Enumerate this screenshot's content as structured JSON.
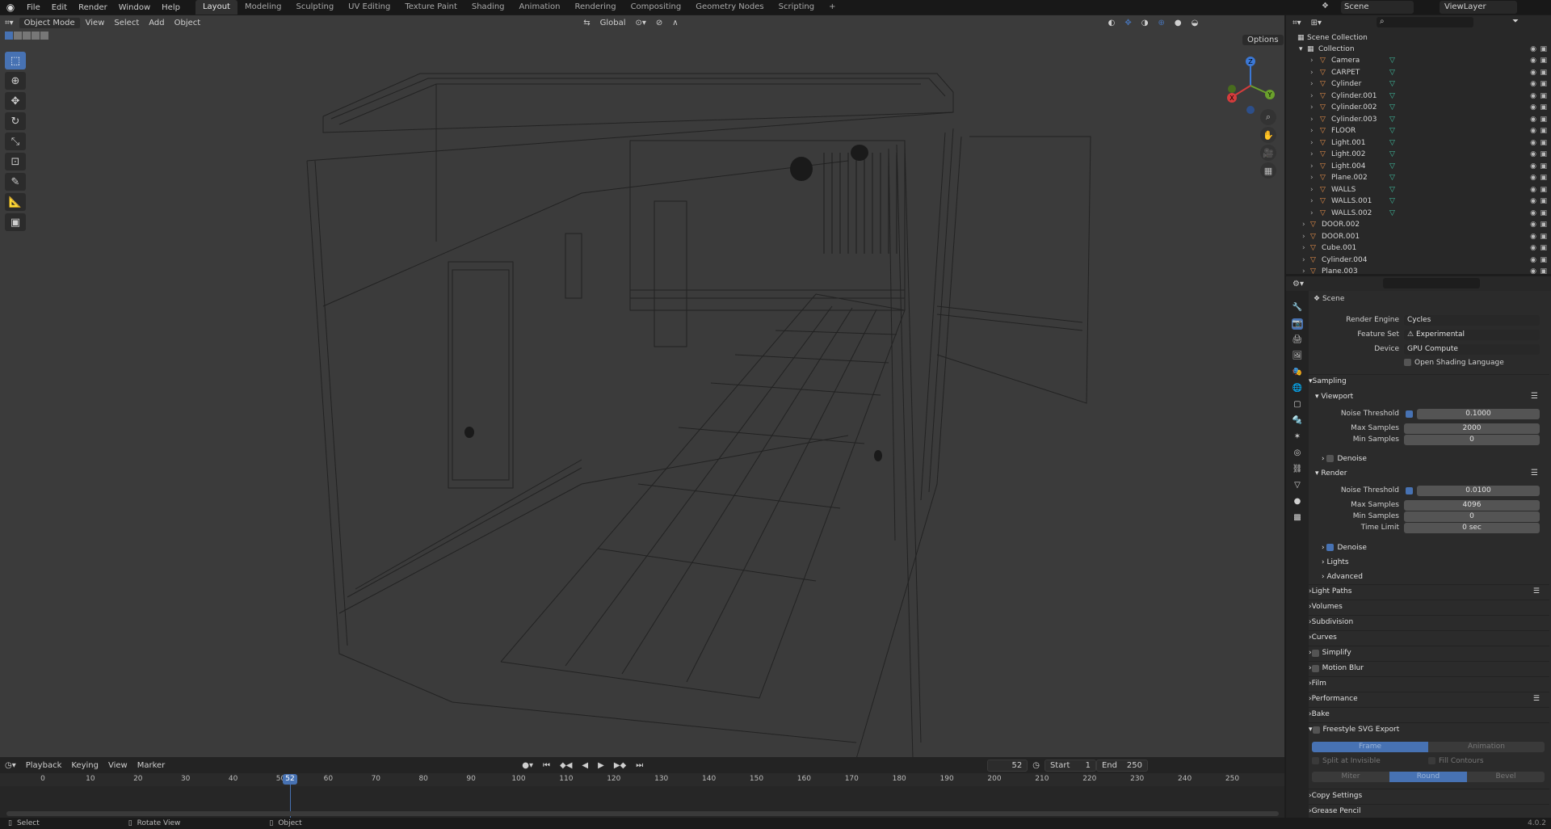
{
  "topbar": {
    "menus": [
      "File",
      "Edit",
      "Render",
      "Window",
      "Help"
    ],
    "workspaces": [
      "Layout",
      "Modeling",
      "Sculpting",
      "UV Editing",
      "Texture Paint",
      "Shading",
      "Animation",
      "Rendering",
      "Compositing",
      "Geometry Nodes",
      "Scripting"
    ],
    "active_workspace": "Layout",
    "add_tab": "+",
    "scene": "Scene",
    "view_layer": "ViewLayer"
  },
  "viewport_header": {
    "mode": "Object Mode",
    "menus": [
      "View",
      "Select",
      "Add",
      "Object"
    ],
    "orientation": "Global",
    "options": "Options"
  },
  "gizmo": {
    "x": "X",
    "y": "Y",
    "z": "Z"
  },
  "outliner": {
    "root": "Scene Collection",
    "collection": "Collection",
    "items": [
      "Camera",
      "CARPET",
      "Cylinder",
      "Cylinder.001",
      "Cylinder.002",
      "Cylinder.003",
      "FLOOR",
      "Light.001",
      "Light.002",
      "Light.004",
      "Plane.002",
      "WALLS",
      "WALLS.001",
      "WALLS.002"
    ],
    "top_items": [
      "DOOR.002",
      "DOOR.001",
      "Cube.001",
      "Cylinder.004",
      "Plane.003"
    ]
  },
  "properties": {
    "context": "Scene",
    "render_engine_label": "Render Engine",
    "render_engine": "Cycles",
    "feature_set_label": "Feature Set",
    "feature_set": "Experimental",
    "device_label": "Device",
    "device": "GPU Compute",
    "osl": "Open Shading Language",
    "sampling": "Sampling",
    "viewport": "Viewport",
    "noise_threshold_label": "Noise Threshold",
    "vp_noise_threshold": "0.1000",
    "max_samples_label": "Max Samples",
    "vp_max_samples": "2000",
    "min_samples_label": "Min Samples",
    "vp_min_samples": "0",
    "denoise": "Denoise",
    "render": "Render",
    "r_noise_threshold": "0.0100",
    "r_max_samples": "4096",
    "r_min_samples": "0",
    "time_limit_label": "Time Limit",
    "r_time_limit": "0 sec",
    "lights": "Lights",
    "advanced": "Advanced",
    "panels": [
      "Light Paths",
      "Volumes",
      "Subdivision",
      "Curves",
      "Simplify",
      "Motion Blur",
      "Film",
      "Performance",
      "Bake",
      "Freestyle SVG Export"
    ],
    "svg_frame": "Frame",
    "svg_animation": "Animation",
    "split_invisible": "Split at Invisible",
    "fill_contours": "Fill Contours",
    "miter": "Miter",
    "round": "Round",
    "bevel": "Bevel",
    "copy_settings": "Copy Settings",
    "grease_pencil": "Grease Pencil",
    "version": "4.0.2"
  },
  "timeline": {
    "menus": [
      "Playback",
      "Keying",
      "View",
      "Marker"
    ],
    "current_frame": "52",
    "start_label": "Start",
    "start": "1",
    "end_label": "End",
    "end": "250",
    "ticks": [
      "0",
      "10",
      "20",
      "30",
      "40",
      "50",
      "60",
      "70",
      "80",
      "90",
      "100",
      "110",
      "120",
      "130",
      "140",
      "150",
      "160",
      "170",
      "180",
      "190",
      "200",
      "210",
      "220",
      "230",
      "240",
      "250"
    ],
    "playhead": "52"
  },
  "statusbar": {
    "select": "Select",
    "rotate": "Rotate View",
    "object": "Object"
  },
  "colors": {
    "accent": "#4772b3",
    "viewport_bg": "#3b3b3b",
    "playhead": "#4772b3"
  }
}
